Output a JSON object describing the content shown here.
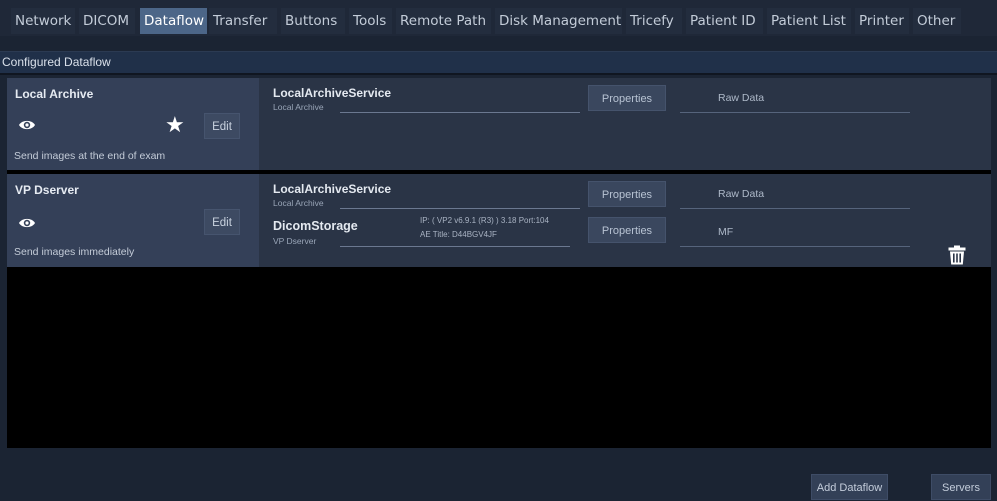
{
  "tabs": [
    {
      "label": "Network"
    },
    {
      "label": "DICOM"
    },
    {
      "label": "Dataflow"
    },
    {
      "label": "Transfer"
    },
    {
      "label": "Buttons"
    },
    {
      "label": "Tools"
    },
    {
      "label": "Remote Path"
    },
    {
      "label": "Disk Management"
    },
    {
      "label": "Tricefy"
    },
    {
      "label": "Patient ID"
    },
    {
      "label": "Patient List"
    },
    {
      "label": "Printer"
    },
    {
      "label": "Other"
    }
  ],
  "active_tab": "Dataflow",
  "section_title": "Configured Dataflow",
  "dataflows": [
    {
      "name": "Local Archive",
      "description": "Send images at the end of exam",
      "edit_label": "Edit",
      "is_default": true,
      "services": [
        {
          "name": "LocalArchiveService",
          "subtitle": "Local Archive",
          "properties_label": "Properties",
          "format": "Raw Data"
        }
      ]
    },
    {
      "name": "VP Dserver",
      "description": "Send images immediately",
      "edit_label": "Edit",
      "is_default": false,
      "services": [
        {
          "name": "LocalArchiveService",
          "subtitle": "Local Archive",
          "properties_label": "Properties",
          "format": "Raw Data"
        },
        {
          "name": "DicomStorage",
          "subtitle": "VP Dserver",
          "info_line1": "IP: ( VP2 v6.9.1 (R3) ) 3.18 Port:104",
          "info_line2": "AE Title: D44BGV4JF",
          "properties_label": "Properties",
          "format": "MF"
        }
      ]
    }
  ],
  "buttons": {
    "add_dataflow": "Add Dataflow",
    "servers": "Servers"
  },
  "colors": {
    "background": "#1b2433",
    "active_tab": "#4c6688",
    "row_left": "#344058",
    "row_right": "#2a3446",
    "list_bg": "#000000"
  }
}
